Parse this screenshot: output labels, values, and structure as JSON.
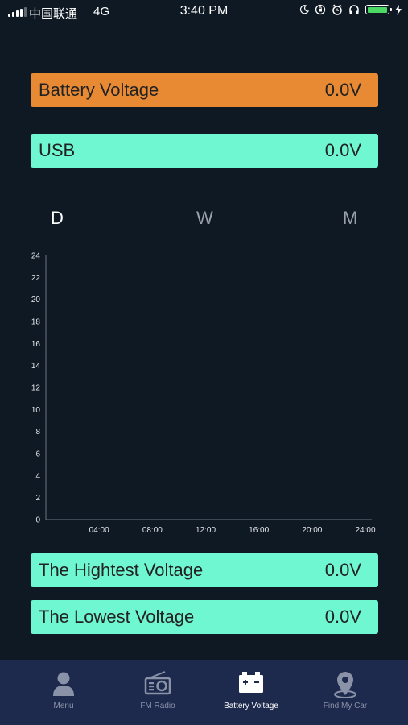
{
  "status_bar": {
    "carrier": "中国联通",
    "network": "4G",
    "time": "3:40 PM",
    "icons": [
      "signal-icon",
      "moon-icon",
      "rotation-lock-icon",
      "alarm-icon",
      "headphones-icon",
      "battery-icon",
      "charging-icon"
    ],
    "battery_level": 0.95,
    "battery_color": "#4cd964"
  },
  "battery_voltage": {
    "label": "Battery Voltage",
    "value": "0.0V",
    "color": "#e78a33"
  },
  "usb": {
    "label": "USB",
    "value": "0.0V",
    "color": "#6ff7d2"
  },
  "period_tabs": [
    {
      "label": "D",
      "selected": true
    },
    {
      "label": "W",
      "selected": false
    },
    {
      "label": "M",
      "selected": false
    }
  ],
  "chart_data": {
    "type": "line",
    "x_ticks": [
      "04:00",
      "08:00",
      "12:00",
      "16:00",
      "20:00",
      "24:00"
    ],
    "y_ticks": [
      "0",
      "2",
      "4",
      "6",
      "8",
      "10",
      "12",
      "14",
      "16",
      "18",
      "20",
      "22",
      "24"
    ],
    "ylim": [
      0,
      24
    ],
    "series": [],
    "grid": false
  },
  "highest": {
    "label": "The Hightest Voltage",
    "value": "0.0V"
  },
  "lowest": {
    "label": "The Lowest Voltage",
    "value": "0.0V"
  },
  "tab_bar": {
    "items": [
      {
        "label": "Menu",
        "icon": "person-icon",
        "active": false
      },
      {
        "label": "FM Radio",
        "icon": "radio-icon",
        "active": false
      },
      {
        "label": "Battery Voltage",
        "icon": "battery-voltage-icon",
        "active": true
      },
      {
        "label": "Find My Car",
        "icon": "location-pin-icon",
        "active": false
      }
    ]
  }
}
